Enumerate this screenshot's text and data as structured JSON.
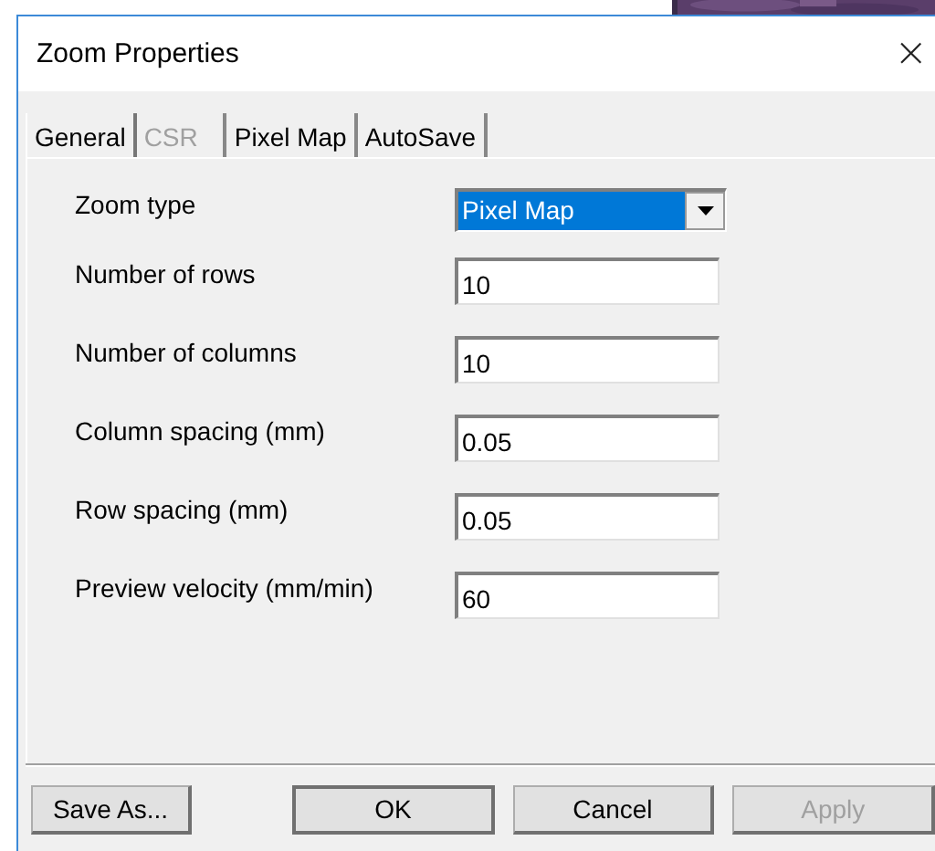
{
  "window": {
    "title": "Zoom Properties",
    "close": "×"
  },
  "tabs": [
    {
      "label": "General",
      "selected": true,
      "disabled": false
    },
    {
      "label": "CSR",
      "selected": false,
      "disabled": true
    },
    {
      "label": "Pixel Map",
      "selected": false,
      "disabled": false
    },
    {
      "label": "AutoSave",
      "selected": false,
      "disabled": false
    }
  ],
  "fields": [
    {
      "kind": "dropdown",
      "label": "Zoom type",
      "value": "Pixel Map"
    },
    {
      "kind": "text",
      "label": "Number of rows",
      "value": "10"
    },
    {
      "kind": "text",
      "label": "Number of columns",
      "value": "10"
    },
    {
      "kind": "text",
      "label": "Column spacing (mm)",
      "value": "0.05"
    },
    {
      "kind": "text",
      "label": "Row spacing (mm)",
      "value": "0.05"
    },
    {
      "kind": "text",
      "label": "Preview velocity (mm/min)",
      "value": "60"
    }
  ],
  "buttons": [
    {
      "label": "Save As...",
      "default": false,
      "disabled": false
    },
    {
      "label": "OK",
      "default": true,
      "disabled": false
    },
    {
      "label": "Cancel",
      "default": false,
      "disabled": false
    },
    {
      "label": "Apply",
      "default": false,
      "disabled": true
    }
  ]
}
